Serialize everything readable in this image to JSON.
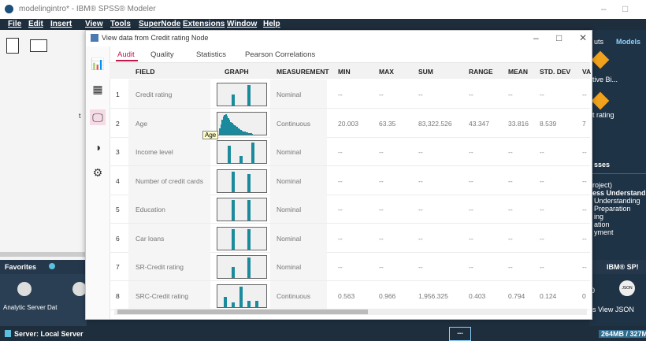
{
  "window": {
    "title": "modelingintro* - IBM® SPSS® Modeler",
    "minimize": "–",
    "maximize": "□"
  },
  "menu": [
    "File",
    "Edit",
    "Insert",
    "View",
    "Tools",
    "SuperNode",
    "Extensions",
    "Window",
    "Help"
  ],
  "right_pane": {
    "tab_outputs": "uts",
    "tab_models": "Models",
    "model1_label": "tive Bi...",
    "model2_label": "t rating",
    "section_title": "sses",
    "crisp_items": [
      "roject)",
      "ess Understandin",
      "Understanding",
      "Preparation",
      "ing",
      "ation",
      "yment"
    ],
    "ibm_label": "IBM® SP!",
    "json_label": "JSON",
    "view_label": "s View   JSON",
    "zero_label": "0"
  },
  "left_pane": {
    "favorites": "Favorites",
    "palette_labels": "Analytic Server  Dat",
    "t_char": "t"
  },
  "status": {
    "server": "Server: Local Server",
    "memory": "264MB / 327M",
    "ellipsis": "..."
  },
  "dialog": {
    "title": "View data from Credit rating Node",
    "minimize": "–",
    "maximize": "□",
    "close": "✕",
    "tabs": [
      "Audit",
      "Quality",
      "Statistics",
      "Pearson Correlations"
    ],
    "active_tab": "Audit",
    "columns": [
      "FIELD",
      "GRAPH",
      "MEASUREMENT",
      "MIN",
      "MAX",
      "SUM",
      "RANGE",
      "MEAN",
      "STD. DEV",
      "VA"
    ],
    "tooltip": "Age",
    "rows": [
      {
        "num": "1",
        "field": "Credit rating",
        "measurement": "Nominal",
        "min": "--",
        "max": "--",
        "sum": "--",
        "range": "--",
        "mean": "--",
        "std": "--",
        "va": "--",
        "graph_bars": [
          0.55,
          1.0
        ]
      },
      {
        "num": "2",
        "field": "Age",
        "measurement": "Continuous",
        "min": "20.003",
        "max": "63.35",
        "sum": "83,322.526",
        "range": "43.347",
        "mean": "33.816",
        "std": "8.539",
        "va": "7",
        "graph_bars": []
      },
      {
        "num": "3",
        "field": "Income level",
        "measurement": "Nominal",
        "min": "--",
        "max": "--",
        "sum": "--",
        "range": "--",
        "mean": "--",
        "std": "--",
        "va": "--",
        "graph_bars": [
          0.85,
          0.35,
          1.0
        ]
      },
      {
        "num": "4",
        "field": "Number of credit cards",
        "measurement": "Nominal",
        "min": "--",
        "max": "--",
        "sum": "--",
        "range": "--",
        "mean": "--",
        "std": "--",
        "va": "--",
        "graph_bars": [
          1.0,
          0.85
        ]
      },
      {
        "num": "5",
        "field": "Education",
        "measurement": "Nominal",
        "min": "--",
        "max": "--",
        "sum": "--",
        "range": "--",
        "mean": "--",
        "std": "--",
        "va": "--",
        "graph_bars": [
          1.0,
          1.0
        ]
      },
      {
        "num": "6",
        "field": "Car loans",
        "measurement": "Nominal",
        "min": "--",
        "max": "--",
        "sum": "--",
        "range": "--",
        "mean": "--",
        "std": "--",
        "va": "--",
        "graph_bars": [
          1.0,
          1.0
        ]
      },
      {
        "num": "7",
        "field": "SR-Credit rating",
        "measurement": "Nominal",
        "min": "--",
        "max": "--",
        "sum": "--",
        "range": "--",
        "mean": "--",
        "std": "--",
        "va": "--",
        "graph_bars": [
          0.55,
          1.0
        ]
      },
      {
        "num": "8",
        "field": "SRC-Credit rating",
        "measurement": "Continuous",
        "min": "0.563",
        "max": "0.966",
        "sum": "1,956.325",
        "range": "0.403",
        "mean": "0.794",
        "std": "0.124",
        "va": "0",
        "graph_bars": [
          0.5,
          0.2,
          1.0,
          0.3,
          0.3
        ]
      }
    ]
  },
  "colors": {
    "accent": "#c0174d",
    "bar": "#1a8a9c",
    "chrome": "#1f2e3d"
  }
}
